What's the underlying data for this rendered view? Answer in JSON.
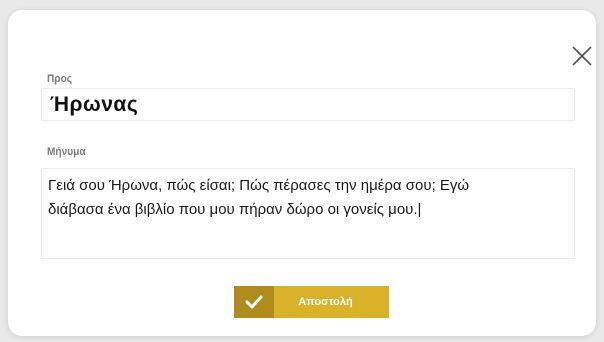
{
  "dialog": {
    "to_label": "Προς",
    "to_value": "Ήρωνας",
    "message_label": "Μήνυμα",
    "message_value": "Γειά σου Ήρωνα, πώς είσαι; Πώς πέρασες την ημέρα σου; Εγώ\nδιάβασα ένα βιβλίο που μου πήραν δώρο οι γονείς μου.|",
    "send_label": "Αποστολή",
    "close_icon": "close-icon",
    "check_icon": "check-icon",
    "accent_color": "#d9b22a",
    "accent_dark_color": "#b08c1e"
  }
}
